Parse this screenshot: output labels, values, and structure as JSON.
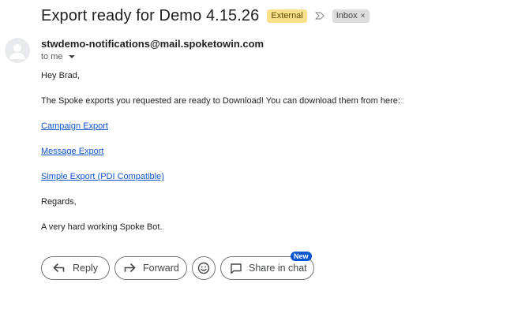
{
  "email": {
    "subject": "Export ready for Demo 4.15.26",
    "badges": {
      "external_label": "External",
      "inbox_label": "Inbox",
      "inbox_close": "×"
    },
    "sender": "stwdemo-notifications@mail.spoketowin.com",
    "recipient_line": "to me",
    "body": {
      "greeting": "Hey Brad,",
      "intro": "The Spoke exports you requested are ready to Download! You can download them from here:",
      "links": [
        {
          "label": "Campaign Export"
        },
        {
          "label": "Message Export"
        },
        {
          "label": "Simple Export (PDI Compatible)"
        }
      ],
      "regards": "Regards,",
      "signature": "A very hard working Spoke Bot."
    }
  },
  "actions": {
    "reply_label": "Reply",
    "forward_label": "Forward",
    "emoji_icon": "smiley-icon",
    "share_label": "Share in chat",
    "new_badge": "New"
  },
  "colors": {
    "external_badge_bg": "#f9e08b",
    "inbox_chip_bg": "#dddddd",
    "link": "#1155cc",
    "new_badge_bg": "#0b57d0",
    "button_border": "#747775"
  }
}
